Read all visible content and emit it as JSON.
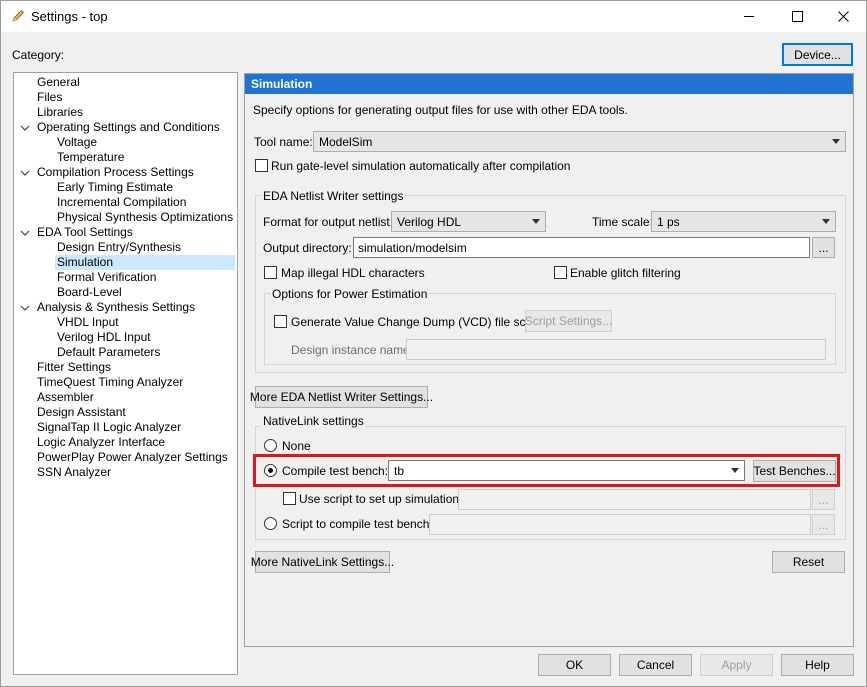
{
  "window": {
    "title": "Settings - top"
  },
  "category_label": "Category:",
  "device_button": "Device...",
  "tree": [
    {
      "label": "General",
      "level": 0
    },
    {
      "label": "Files",
      "level": 0
    },
    {
      "label": "Libraries",
      "level": 0
    },
    {
      "label": "Operating Settings and Conditions",
      "level": 0,
      "expanded": true
    },
    {
      "label": "Voltage",
      "level": 1
    },
    {
      "label": "Temperature",
      "level": 1
    },
    {
      "label": "Compilation Process Settings",
      "level": 0,
      "expanded": true
    },
    {
      "label": "Early Timing Estimate",
      "level": 1
    },
    {
      "label": "Incremental Compilation",
      "level": 1
    },
    {
      "label": "Physical Synthesis Optimizations",
      "level": 1
    },
    {
      "label": "EDA Tool Settings",
      "level": 0,
      "expanded": true
    },
    {
      "label": "Design Entry/Synthesis",
      "level": 1
    },
    {
      "label": "Simulation",
      "level": 1,
      "selected": true
    },
    {
      "label": "Formal Verification",
      "level": 1
    },
    {
      "label": "Board-Level",
      "level": 1
    },
    {
      "label": "Analysis & Synthesis Settings",
      "level": 0,
      "expanded": true
    },
    {
      "label": "VHDL Input",
      "level": 1
    },
    {
      "label": "Verilog HDL Input",
      "level": 1
    },
    {
      "label": "Default Parameters",
      "level": 1
    },
    {
      "label": "Fitter Settings",
      "level": 0
    },
    {
      "label": "TimeQuest Timing Analyzer",
      "level": 0
    },
    {
      "label": "Assembler",
      "level": 0
    },
    {
      "label": "Design Assistant",
      "level": 0
    },
    {
      "label": "SignalTap II Logic Analyzer",
      "level": 0
    },
    {
      "label": "Logic Analyzer Interface",
      "level": 0
    },
    {
      "label": "PowerPlay Power Analyzer Settings",
      "level": 0
    },
    {
      "label": "SSN Analyzer",
      "level": 0
    }
  ],
  "panel": {
    "header": "Simulation",
    "description": "Specify options for generating output files for use with other EDA tools.",
    "tool_name_label": "Tool name:",
    "tool_name_value": "ModelSim",
    "run_gate_level_label": "Run gate-level simulation automatically after compilation",
    "eda_group_title": "EDA Netlist Writer settings",
    "format_label": "Format for output netlist:",
    "format_value": "Verilog HDL",
    "time_scale_label": "Time scale:",
    "time_scale_value": "1 ps",
    "output_dir_label": "Output directory:",
    "output_dir_value": "simulation/modelsim",
    "browse": "...",
    "map_illegal_label": "Map illegal HDL characters",
    "glitch_label": "Enable glitch filtering",
    "power_group_title": "Options for Power Estimation",
    "vcd_label": "Generate Value Change Dump (VCD) file script",
    "script_settings_button": "Script Settings...",
    "design_instance_label": "Design instance name:",
    "more_eda_button": "More EDA Netlist Writer Settings...",
    "nativelink_group_title": "NativeLink settings",
    "none_label": "None",
    "compile_tb_label": "Compile test bench:",
    "compile_tb_value": "tb",
    "test_benches_button": "Test Benches...",
    "use_script_label": "Use script to set up simulation:",
    "script_compile_label": "Script to compile test bench:",
    "more_nativelink_button": "More NativeLink Settings...",
    "reset_button": "Reset"
  },
  "footer": {
    "ok": "OK",
    "cancel": "Cancel",
    "apply": "Apply",
    "help": "Help"
  },
  "colors": {
    "header_bg": "#1e73d3",
    "selection": "#cce8ff",
    "highlight": "#e0161b"
  }
}
